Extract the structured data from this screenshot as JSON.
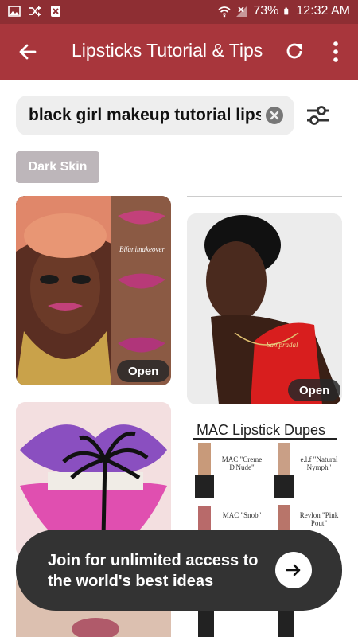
{
  "status_bar": {
    "battery": "73%",
    "time": "12:32 AM"
  },
  "app_bar": {
    "title": "Lipsticks Tutorial & Tips"
  },
  "search": {
    "query": "black girl makeup tutorial lipstick"
  },
  "chips": [
    {
      "label": "Dark Skin"
    }
  ],
  "pins": [
    {
      "open_label": "Open",
      "watermark": "Bifanimakeover"
    },
    {
      "open_label": "Open",
      "necklace_text": "Sampradal"
    },
    {},
    {
      "title": "MAC Lipstick Dupes",
      "labels": [
        "MAC \"Creme D'Nude\"",
        "e.l.f \"Natural Nymph\"",
        "MAC \"Snob\"",
        "Revlon \"Pink Pout\""
      ]
    }
  ],
  "join_toast": {
    "message": "Join for unlimited access to the world's best ideas"
  },
  "colors": {
    "status_bar": "#8e2e33",
    "app_bar": "#a8363c",
    "chip": "#bdb6ba"
  }
}
